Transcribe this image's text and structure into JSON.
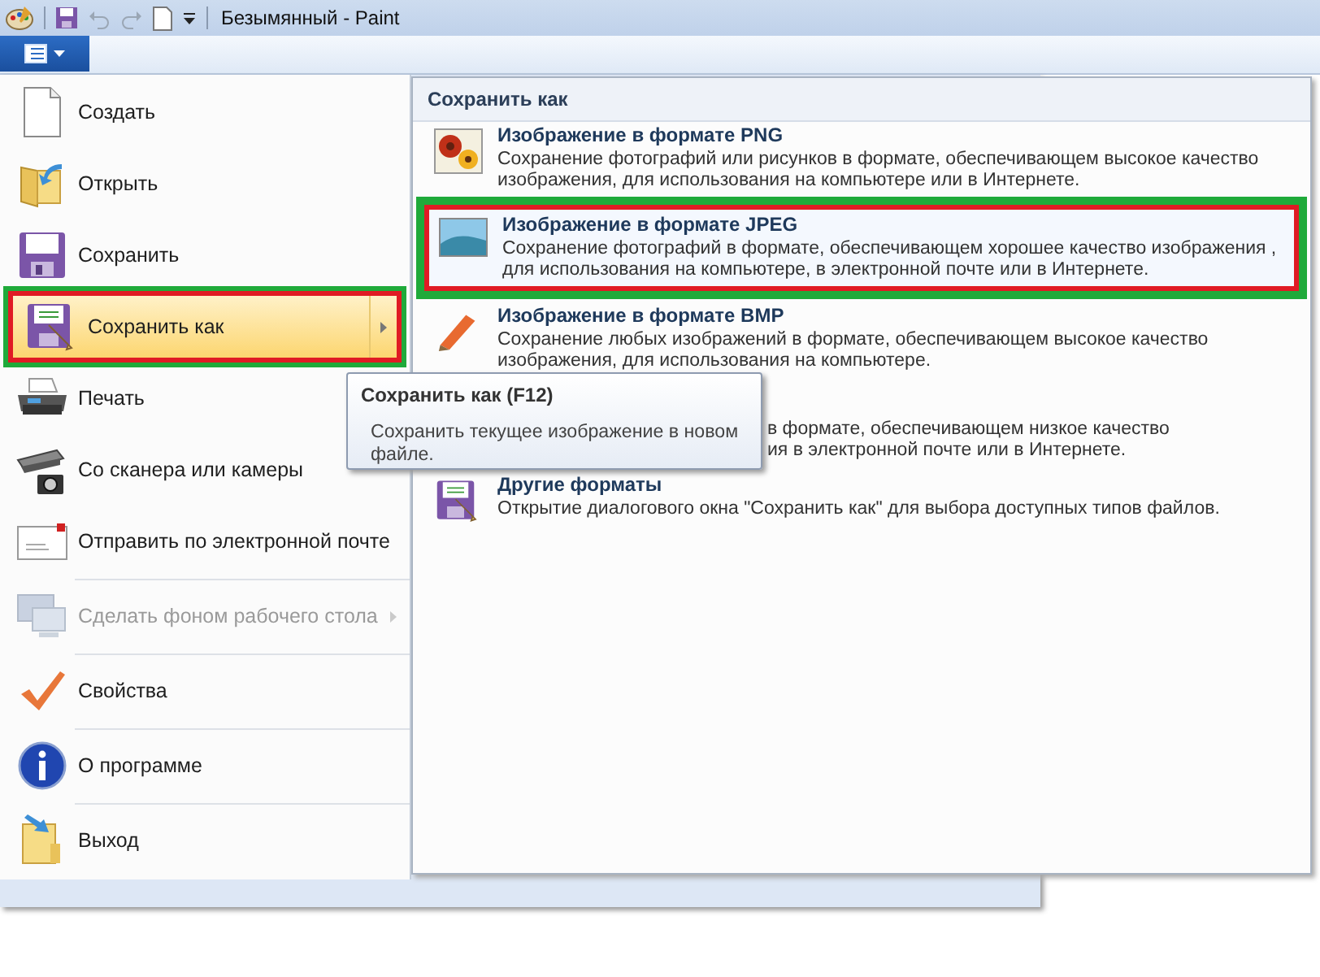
{
  "window": {
    "title": "Безымянный - Paint"
  },
  "file_menu": {
    "items": [
      {
        "label": "Создать",
        "selected": false,
        "disabled": false,
        "submenu": false,
        "separator_above": false
      },
      {
        "label": "Открыть",
        "selected": false,
        "disabled": false,
        "submenu": false,
        "separator_above": false
      },
      {
        "label": "Сохранить",
        "selected": false,
        "disabled": false,
        "submenu": false,
        "separator_above": false
      },
      {
        "label": "Сохранить как",
        "selected": true,
        "disabled": false,
        "submenu": true,
        "separator_above": false
      },
      {
        "label": "Печать",
        "selected": false,
        "disabled": false,
        "submenu": false,
        "separator_above": false
      },
      {
        "label": "Со сканера или камеры",
        "selected": false,
        "disabled": false,
        "submenu": false,
        "separator_above": false
      },
      {
        "label": "Отправить по электронной почте",
        "selected": false,
        "disabled": false,
        "submenu": false,
        "separator_above": false
      },
      {
        "label": "Сделать фоном рабочего стола",
        "selected": false,
        "disabled": true,
        "submenu": true,
        "separator_above": true
      },
      {
        "label": "Свойства",
        "selected": false,
        "disabled": false,
        "submenu": false,
        "separator_above": true
      },
      {
        "label": "О программе",
        "selected": false,
        "disabled": false,
        "submenu": false,
        "separator_above": true
      },
      {
        "label": "Выход",
        "selected": false,
        "disabled": false,
        "submenu": false,
        "separator_above": true
      }
    ]
  },
  "save_as_panel": {
    "title": "Сохранить как",
    "items": [
      {
        "kind": "format",
        "title": "Изображение в формате PNG",
        "description": "Сохранение фотографий или рисунков в формате, обеспечивающем высокое качество изображения, для использования на компьютере или в Интернете.",
        "selected": false
      },
      {
        "kind": "format",
        "title": "Изображение в формате JPEG",
        "description": "Сохранение фотографий в формате, обеспечивающем хорошее качество изображения , для использования на компьютере, в электронной почте или в Интернете.",
        "selected": true
      },
      {
        "kind": "format",
        "title": "Изображение в формате BMP",
        "description": "Сохранение любых изображений в формате, обеспечивающем высокое качество изображения, для использования на компьютере.",
        "selected": false
      },
      {
        "kind": "covered",
        "lines": [
          "в формате, обеспечивающем низкое качество",
          "ия в электронной почте или в Интернете."
        ]
      },
      {
        "kind": "format",
        "title": "Другие форматы",
        "description": "Открытие диалогового окна \"Сохранить как\" для выбора доступных типов файлов.",
        "selected": false
      }
    ]
  },
  "tooltip": {
    "title": "Сохранить как (F12)",
    "text": "Сохранить текущее изображение в новом файле."
  }
}
